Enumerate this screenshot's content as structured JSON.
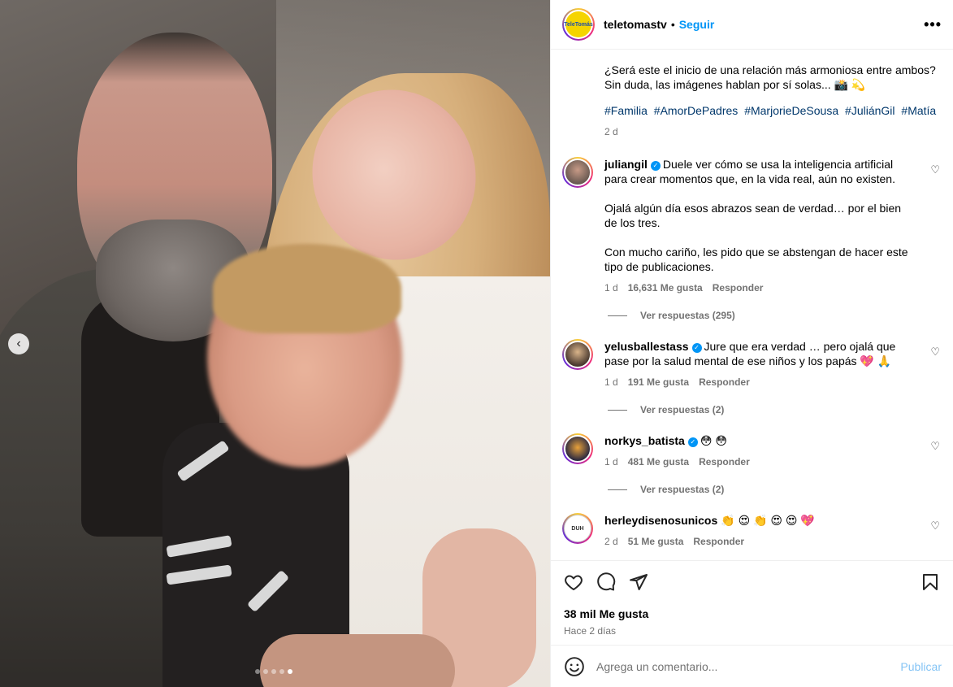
{
  "post": {
    "author": "teletomastv",
    "logo_text": "TeleTomás",
    "separator": "•",
    "follow_label": "Seguir",
    "more_label": "•••",
    "caption_lines": [
      "¿Será este el inicio de una relación más armoniosa entre ambos?",
      "Sin duda, las imágenes hablan por sí solas... 📸 💫"
    ],
    "hashtags": [
      "#Familia",
      "#AmorDePadres",
      "#MarjorieDeSousa",
      "#JuliánGil",
      "#Matía"
    ],
    "caption_age": "2 d",
    "likes": "38 mil Me gusta",
    "posted_ago": "Hace 2 días",
    "carousel": {
      "slides": 5,
      "active_index": 4
    }
  },
  "comments": [
    {
      "user": "juliangil",
      "verified": true,
      "paragraphs": [
        "Duele ver cómo se usa la inteligencia artificial para crear momentos que, en la vida real, aún no existen.",
        "Ojalá algún día esos abrazos sean de verdad… por el bien de los tres.",
        "Con mucho cariño, les pido que se abstengan de hacer este tipo de publicaciones."
      ],
      "age": "1 d",
      "likes": "16,631 Me gusta",
      "reply_label": "Responder",
      "replies_label": "Ver respuestas (295)"
    },
    {
      "user": "yelusballestass",
      "verified": true,
      "paragraphs": [
        "Jure que era verdad … pero ojalá que pase por la salud mental de ese niños y los papás 💖 🙏"
      ],
      "age": "1 d",
      "likes": "191 Me gusta",
      "reply_label": "Responder",
      "replies_label": "Ver respuestas (2)"
    },
    {
      "user": "norkys_batista",
      "verified": true,
      "paragraphs": [
        "😳 😳"
      ],
      "age": "1 d",
      "likes": "481 Me gusta",
      "reply_label": "Responder",
      "replies_label": "Ver respuestas (2)"
    },
    {
      "user": "herleydisenosunicos",
      "verified": false,
      "paragraphs": [
        "👏 😍 👏 😍 😍 💖"
      ],
      "age": "2 d",
      "likes": "51 Me gusta",
      "reply_label": "Responder",
      "avatar_text": "DUH"
    }
  ],
  "composer": {
    "placeholder": "Agrega un comentario...",
    "publish_label": "Publicar"
  },
  "colors": {
    "link_blue": "#0095f6",
    "hashtag": "#00376b",
    "muted": "#737373",
    "publish_disabled": "#85c4f5"
  },
  "icons": [
    "chevron-left-icon",
    "more-icon",
    "heart-icon",
    "comment-icon",
    "share-icon",
    "bookmark-icon",
    "emoji-icon",
    "verified-icon"
  ]
}
